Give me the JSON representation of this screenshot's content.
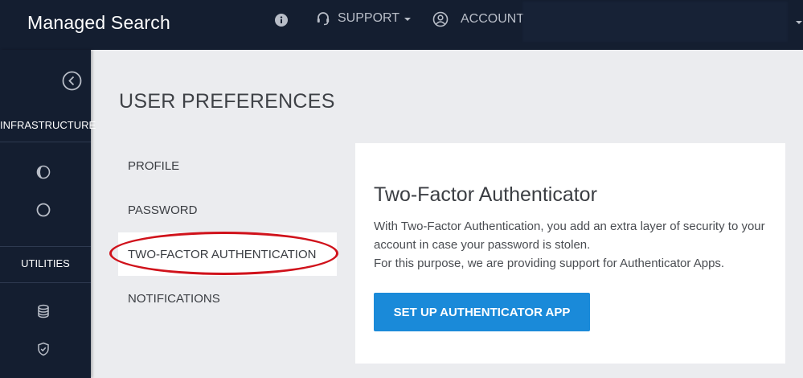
{
  "header": {
    "brand": "Managed Search",
    "support_label": "SUPPORT",
    "account_label": "ACCOUNT:",
    "icons": [
      "info-icon",
      "headset-icon",
      "user-circle-icon"
    ]
  },
  "sidebar": {
    "sections": [
      {
        "label": "INFRASTRUCTURE",
        "icons": [
          "half-circle-icon",
          "circle-icon"
        ]
      },
      {
        "label": "UTILITIES",
        "icons": [
          "database-icon",
          "shield-check-icon"
        ]
      }
    ]
  },
  "page": {
    "title": "USER PREFERENCES"
  },
  "nav": {
    "items": [
      {
        "label": "PROFILE"
      },
      {
        "label": "PASSWORD"
      },
      {
        "label": "TWO-FACTOR AUTHENTICATION",
        "active": true
      },
      {
        "label": "NOTIFICATIONS"
      }
    ]
  },
  "card": {
    "title": "Two-Factor Authenticator",
    "paragraph1": "With Two-Factor Authentication, you add an extra layer of security to your account in case your password is stolen.",
    "paragraph2": "For this purpose, we are providing support for Authenticator Apps.",
    "button_label": "SET UP AUTHENTICATOR APP"
  },
  "colors": {
    "nav_bg": "#141e30",
    "accent": "#1a8ad9",
    "highlight": "#d0121b",
    "page_bg": "#ebecef"
  }
}
